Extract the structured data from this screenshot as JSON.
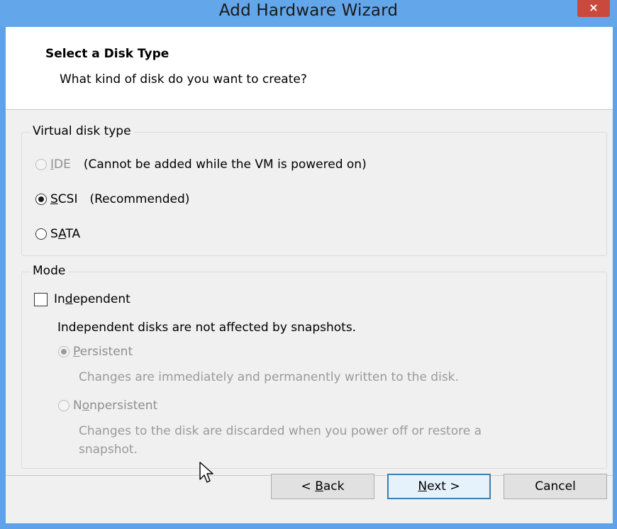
{
  "window": {
    "title": "Add Hardware Wizard",
    "close_label": "×"
  },
  "header": {
    "title": "Select a Disk Type",
    "subtitle": "What kind of disk do you want to create?"
  },
  "disk_type": {
    "group_label": "Virtual disk type",
    "options": [
      {
        "label_access": "I",
        "label_rest": "DE",
        "note": "(Cannot be added while the VM is powered on)",
        "checked": false,
        "enabled": false
      },
      {
        "label_access": "S",
        "label_rest": "CSI",
        "note": "(Recommended)",
        "checked": true,
        "enabled": true
      },
      {
        "label_pre": "S",
        "label_access": "A",
        "label_rest": "TA",
        "checked": false,
        "enabled": true
      }
    ]
  },
  "mode": {
    "group_label": "Mode",
    "independent": {
      "label_pre": "In",
      "label_access": "d",
      "label_rest": "ependent",
      "checked": false
    },
    "independent_note": "Independent disks are not affected by snapshots.",
    "persistent": {
      "label_access": "P",
      "label_rest": "ersistent",
      "description": "Changes are immediately and permanently written to the disk.",
      "checked": true,
      "enabled": false
    },
    "nonpersistent": {
      "label_pre": "N",
      "label_access": "o",
      "label_rest": "npersistent",
      "description_line1": "Changes to the disk are discarded when you power off or restore a",
      "description_line2": "snapshot.",
      "checked": false,
      "enabled": false
    }
  },
  "footer": {
    "back_pre": "< ",
    "back_access": "B",
    "back_rest": "ack",
    "next_access": "N",
    "next_rest": "ext >",
    "cancel_label": "Cancel"
  }
}
